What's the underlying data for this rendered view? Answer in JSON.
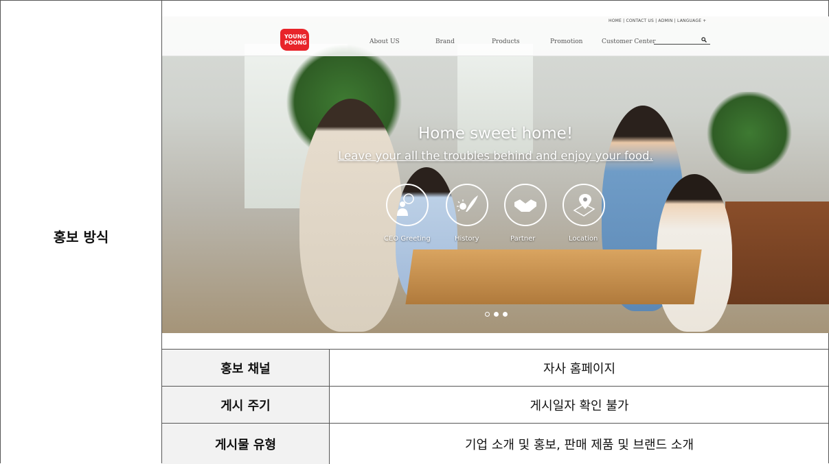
{
  "left_label": "홍보 방식",
  "site": {
    "logo_text_line1": "YOUNG",
    "logo_text_line2": "POONG",
    "util_links": "HOME  |  CONTACT US  |  ADMIN  |  LANGUAGE +",
    "nav": [
      "About US",
      "Brand",
      "Products",
      "Promotion",
      "Customer Center"
    ],
    "hero_title": "Home sweet home!",
    "hero_subtitle": "Leave your all the troubles behind and enjoy your food.",
    "quick_links": [
      "CEO Greeting",
      "History",
      "Partner",
      "Location"
    ],
    "slider_dots": [
      "inactive",
      "active",
      "active"
    ]
  },
  "table": {
    "rows": [
      {
        "header": "홍보 채널",
        "value": "자사 홈페이지"
      },
      {
        "header": "게시 주기",
        "value": "게시일자 확인 불가"
      },
      {
        "header": "게시물 유형",
        "value": "기업 소개 및 홍보, 판매 제품 및 브랜드 소개"
      }
    ]
  }
}
